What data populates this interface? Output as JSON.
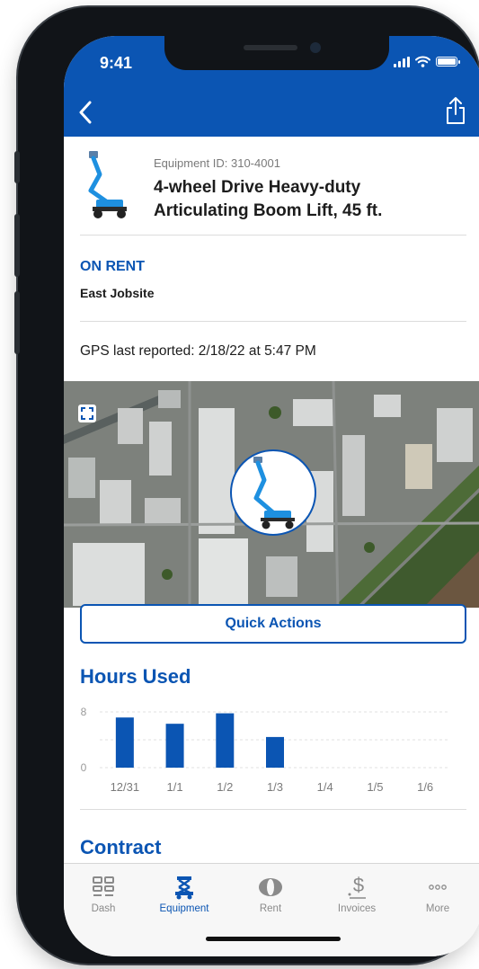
{
  "status_bar": {
    "time": "9:41"
  },
  "nav": {
    "back_icon": "chevron-left-icon",
    "share_icon": "share-icon"
  },
  "equipment": {
    "id_label": "Equipment ID: 310-4001",
    "title": "4-wheel Drive Heavy-duty Articulating Boom Lift, 45 ft.",
    "thumbnail_icon": "boom-lift-icon"
  },
  "rental": {
    "status": "ON RENT",
    "site": "East Jobsite"
  },
  "gps": {
    "text": "GPS last reported: 2/18/22 at 5:47 PM"
  },
  "map": {
    "expand_icon": "expand-icon",
    "marker_icon": "boom-lift-icon"
  },
  "quick_actions": {
    "label": "Quick Actions"
  },
  "hours_used": {
    "title": "Hours Used"
  },
  "chart_data": {
    "type": "bar",
    "categories": [
      "12/31",
      "1/1",
      "1/2",
      "1/3",
      "1/4",
      "1/5",
      "1/6"
    ],
    "values": [
      7.2,
      6.3,
      7.8,
      4.4,
      0,
      0,
      0
    ],
    "ylim": [
      0,
      8
    ],
    "yticks": [
      "8",
      "0"
    ],
    "grid": true,
    "bar_color": "#0b55b3"
  },
  "next_section": {
    "title": "Contract"
  },
  "tabs": [
    {
      "label": "Dash",
      "icon": "dashboard-icon",
      "active": false
    },
    {
      "label": "Equipment",
      "icon": "equipment-icon",
      "active": true
    },
    {
      "label": "Rent",
      "icon": "rent-icon",
      "active": false
    },
    {
      "label": "Invoices",
      "icon": "invoice-dollar-icon",
      "active": false
    },
    {
      "label": "More",
      "icon": "more-dots-icon",
      "active": false
    }
  ],
  "colors": {
    "brand": "#0b55b3",
    "text": "#1c1c1c",
    "muted": "#7a7a7a"
  }
}
